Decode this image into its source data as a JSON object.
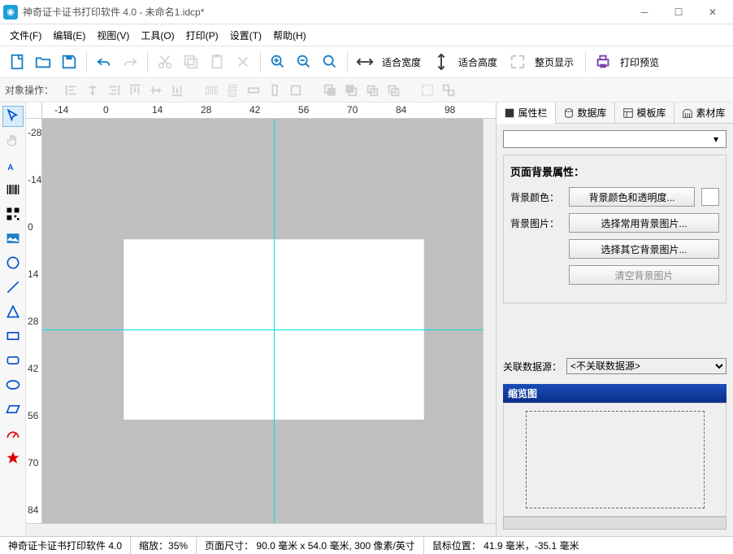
{
  "title": "神奇证卡证书打印软件 4.0 - 未命名1.idcp*",
  "menu": {
    "file": "文件(F)",
    "edit": "编辑(E)",
    "view": "视图(V)",
    "tool": "工具(O)",
    "print": "打印(P)",
    "settings": "设置(T)",
    "help": "帮助(H)"
  },
  "toolbar": {
    "fit_width": "适合宽度",
    "fit_height": "适合高度",
    "full_page": "整页显示",
    "print_preview": "打印预览"
  },
  "objbar": {
    "label": "对象操作："
  },
  "ruler_h": [
    "-14",
    "0",
    "14",
    "28",
    "42",
    "56",
    "70",
    "84",
    "98"
  ],
  "ruler_v": [
    "-28",
    "-14",
    "0",
    "14",
    "28",
    "42",
    "56",
    "70",
    "84"
  ],
  "rtabs": {
    "props": "属性栏",
    "db": "数据库",
    "tmpl": "模板库",
    "assets": "素材库"
  },
  "props": {
    "section_title": "页面背景属性：",
    "bg_color_label": "背景颜色：",
    "bg_color_btn": "背景颜色和透明度...",
    "bg_img_label": "背景图片：",
    "bg_img_btn1": "选择常用背景图片...",
    "bg_img_btn2": "选择其它背景图片...",
    "bg_img_clear": "清空背景图片",
    "datasrc_label": "关联数据源：",
    "datasrc_value": "<不关联数据源>",
    "thumb_title": "缩览图"
  },
  "status": {
    "app": "神奇证卡证书打印软件 4.0",
    "zoom": "缩放：35%",
    "size": "页面尺寸： 90.0 毫米 x 54.0 毫米, 300 像素/英寸",
    "mouse": "鼠标位置： 41.9 毫米，-35.1 毫米"
  }
}
